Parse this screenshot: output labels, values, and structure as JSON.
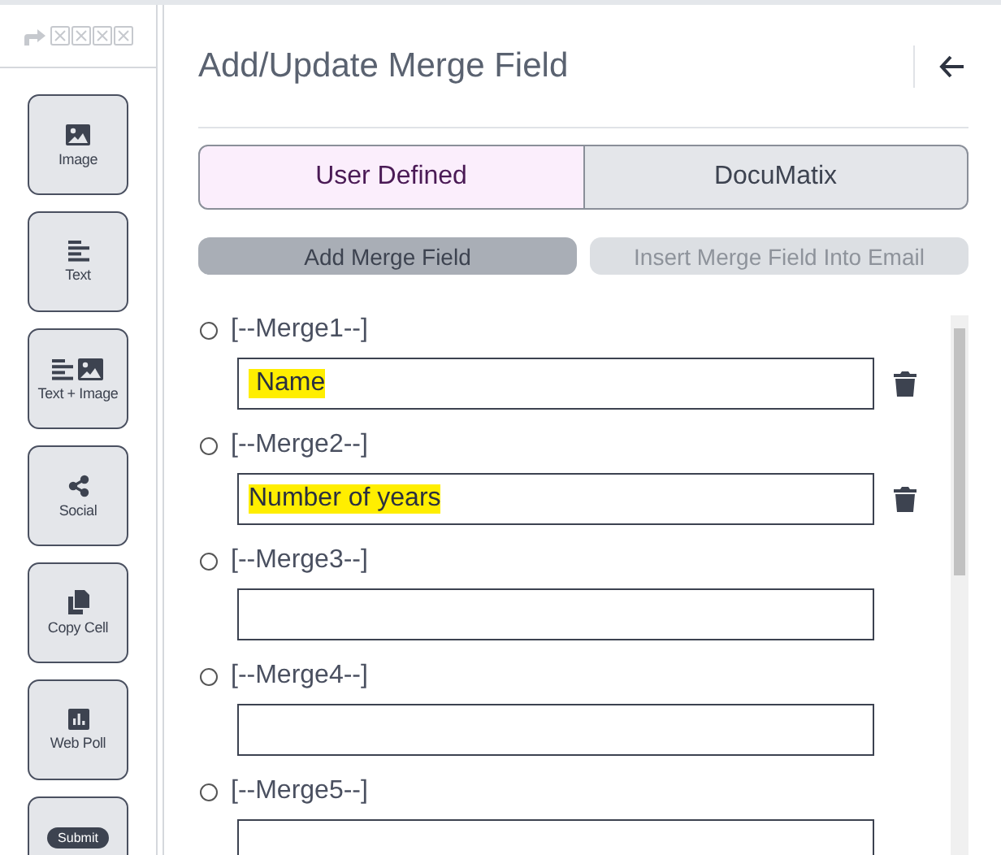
{
  "tiles": [
    {
      "kind": "image",
      "label": "Image"
    },
    {
      "kind": "text",
      "label": "Text"
    },
    {
      "kind": "text_image",
      "label": "Text + Image"
    },
    {
      "kind": "social",
      "label": "Social"
    },
    {
      "kind": "copy",
      "label": "Copy Cell"
    },
    {
      "kind": "poll",
      "label": "Web Poll"
    },
    {
      "kind": "badge",
      "badge": "Submit"
    }
  ],
  "panel": {
    "title": "Add/Update Merge Field"
  },
  "tabs": [
    {
      "label": "User Defined",
      "selected": true
    },
    {
      "label": "DocuMatix",
      "selected": false
    }
  ],
  "buttons": [
    {
      "label": "Add Merge Field",
      "disabled": false
    },
    {
      "label": "Insert Merge Field Into Email",
      "disabled": true
    }
  ],
  "merge_fields": [
    {
      "label": "[--Merge1--]",
      "selected": false,
      "value": " Name",
      "highlighted": true,
      "deletable": true
    },
    {
      "label": "[--Merge2--]",
      "selected": false,
      "value": "Number of years",
      "highlighted": true,
      "deletable": true
    },
    {
      "label": "[--Merge3--]",
      "selected": false,
      "deletable": false
    },
    {
      "label": "[--Merge4--]",
      "selected": false,
      "deletable": false
    },
    {
      "label": "[--Merge5--]",
      "selected": false,
      "deletable": false
    }
  ]
}
